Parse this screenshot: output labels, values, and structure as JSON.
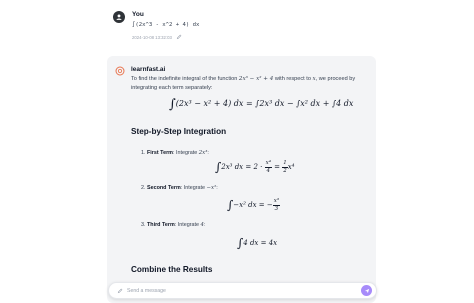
{
  "user": {
    "name": "You",
    "message": "∫(2x^3 - x^2 + 4) dx",
    "timestamp": "2024-10-08 13:32:03"
  },
  "assistant": {
    "name": "learnfast.ai",
    "intro_1": "To find the indefinite integral of the function ",
    "intro_fn": "2x³ − x² + 4",
    "intro_2": " with respect to ",
    "intro_var": "x",
    "intro_3": ", we proceed by integrating each term separately:",
    "main_equation": "(2x³ − x² + 4) dx = ∫2x³ dx − ∫x² dx + ∫4 dx",
    "step_heading": "Step-by-Step Integration",
    "steps": [
      {
        "index": "1.",
        "title": "First Term",
        "text": ": Integrate ",
        "expr": "2x³",
        "tail": ":"
      },
      {
        "index": "2.",
        "title": "Second Term",
        "text": ": Integrate ",
        "expr": "−x²",
        "tail": ":"
      },
      {
        "index": "3.",
        "title": "Third Term",
        "text": ": Integrate ",
        "expr": "4",
        "tail": ":"
      }
    ],
    "eq1_left": "2x³ dx = 2 ·",
    "eq1_frac1_num": "x⁴",
    "eq1_frac1_den": "4",
    "eq1_mid": "=",
    "eq1_frac2_num": "1",
    "eq1_frac2_den": "2",
    "eq1_right": "x⁴",
    "eq2_left": "−x² dx = −",
    "eq2_frac_num": "x³",
    "eq2_frac_den": "3",
    "eq3": "4 dx = 4x",
    "combine_heading": "Combine the Results"
  },
  "input": {
    "placeholder": "Send a message"
  },
  "colors": {
    "card_bg": "#f3f4f6",
    "send_button": "#a78bfa",
    "logo": "#e8744f"
  }
}
